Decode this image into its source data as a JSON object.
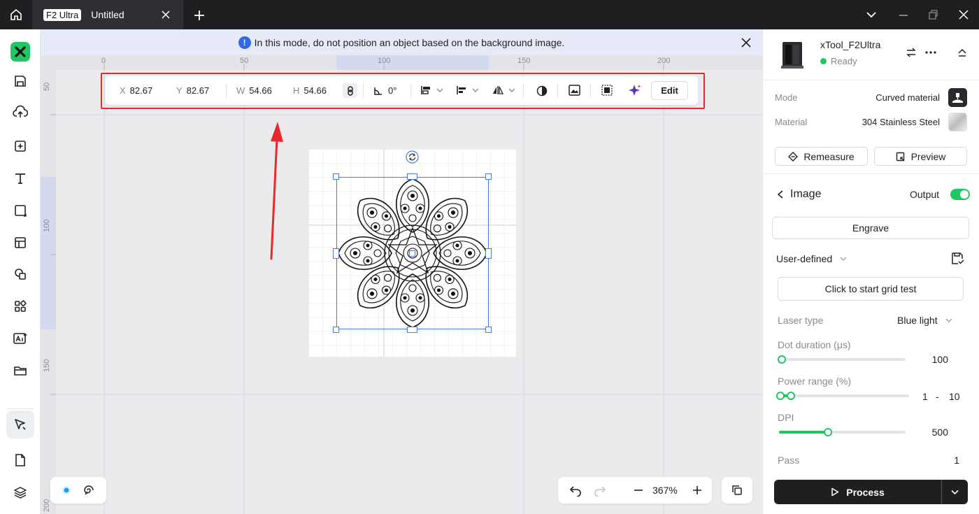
{
  "titlebar": {
    "tab_badge": "F2 Ultra",
    "tab_title": "Untitled"
  },
  "canvas": {
    "notice": "In this mode, do not position an object based on the background image.",
    "ruler_h": [
      "0",
      "50",
      "100",
      "150",
      "200"
    ],
    "ruler_v": [
      "50",
      "100",
      "150",
      "200"
    ],
    "props": {
      "x_label": "X",
      "x_value": "82.67",
      "y_label": "Y",
      "y_value": "82.67",
      "w_label": "W",
      "w_value": "54.66",
      "h_label": "H",
      "h_value": "54.66",
      "rotation": "0°",
      "edit_label": "Edit"
    },
    "zoom": "367%"
  },
  "panel": {
    "device_name": "xTool_F2Ultra",
    "device_status": "Ready",
    "mode_label": "Mode",
    "mode_value": "Curved material",
    "material_label": "Material",
    "material_value": "304 Stainless Steel",
    "remeasure_label": "Remeasure",
    "preview_label": "Preview",
    "section_title": "Image",
    "output_label": "Output",
    "output_on": true,
    "engrave_label": "Engrave",
    "preset": "User-defined",
    "grid_test_label": "Click to start grid test",
    "laser_type_label": "Laser type",
    "laser_type_value": "Blue light",
    "dot_duration_label": "Dot duration (μs)",
    "dot_duration_value": "100",
    "power_range_label": "Power range (%)",
    "power_min": "1",
    "power_dash": "-",
    "power_max": "10",
    "dpi_label": "DPI",
    "dpi_value": "500",
    "pass_label": "Pass",
    "pass_value": "1",
    "process_label": "Process"
  },
  "colors": {
    "accent": "#1ec761",
    "selection": "#4a78d8",
    "highlight": "#e8292d",
    "titlebar": "#1f1f22"
  }
}
